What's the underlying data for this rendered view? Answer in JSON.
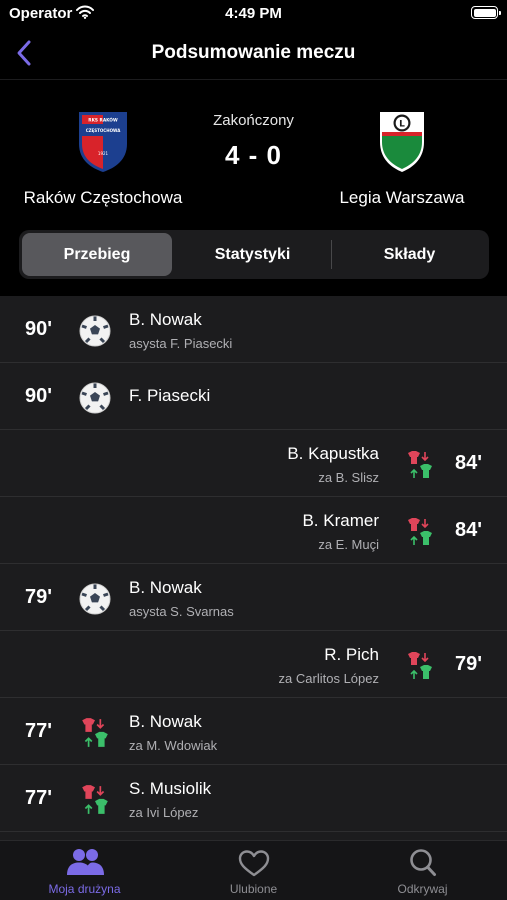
{
  "status_bar": {
    "carrier": "Operator",
    "time": "4:49 PM"
  },
  "nav": {
    "title": "Podsumowanie meczu",
    "back_icon": "chevron-left-icon",
    "accent": "#7b6be6"
  },
  "match": {
    "home": {
      "name": "Raków Częstochowa",
      "crest_text": "RKS RAKÓW CZĘSTOCHOWA",
      "crest_year": "1921"
    },
    "away": {
      "name": "Legia Warszawa",
      "crest_text": "L"
    },
    "status": "Zakończony",
    "score": "4 - 0"
  },
  "tabs": {
    "items": [
      "Przebieg",
      "Statystyki",
      "Składy"
    ],
    "selected": "Przebieg"
  },
  "events": [
    {
      "minute": "90'",
      "side": "left",
      "type": "goal",
      "player": "B. Nowak",
      "detail": "asysta F. Piasecki"
    },
    {
      "minute": "90'",
      "side": "left",
      "type": "goal",
      "player": "F. Piasecki",
      "detail": ""
    },
    {
      "minute": "84'",
      "side": "right",
      "type": "substitution",
      "player": "B. Kapustka",
      "detail": "za B. Slisz"
    },
    {
      "minute": "84'",
      "side": "right",
      "type": "substitution",
      "player": "B. Kramer",
      "detail": "za E. Muçi"
    },
    {
      "minute": "79'",
      "side": "left",
      "type": "goal",
      "player": "B. Nowak",
      "detail": "asysta S. Svarnas"
    },
    {
      "minute": "79'",
      "side": "right",
      "type": "substitution",
      "player": "R. Pich",
      "detail": "za Carlitos López"
    },
    {
      "minute": "77'",
      "side": "left",
      "type": "substitution",
      "player": "B. Nowak",
      "detail": "za M. Wdowiak"
    },
    {
      "minute": "77'",
      "side": "left",
      "type": "substitution",
      "player": "S. Musiolik",
      "detail": "za Ivi López"
    }
  ],
  "tabbar": {
    "items": [
      {
        "label": "Moja drużyna",
        "icon": "team-icon",
        "active": true
      },
      {
        "label": "Ulubione",
        "icon": "heart-icon",
        "active": false
      },
      {
        "label": "Odkrywaj",
        "icon": "search-icon",
        "active": false
      }
    ],
    "active_color": "#7b6be6",
    "inactive_color": "#8e8e93"
  }
}
